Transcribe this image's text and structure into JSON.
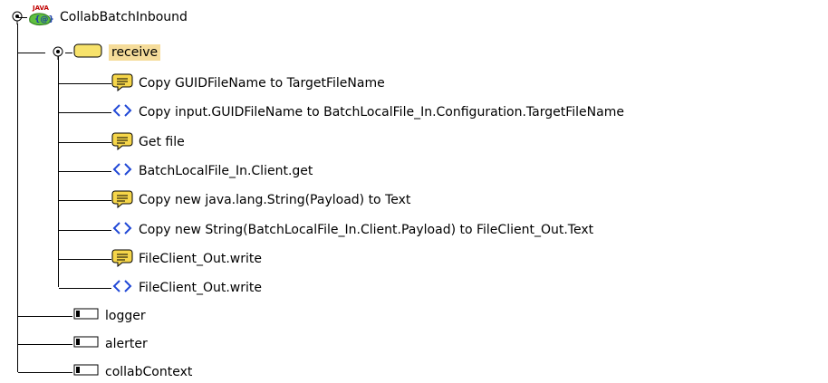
{
  "tree": {
    "root": {
      "label": "CollabBatchInbound",
      "icon": "java-collaboration-icon",
      "badge": "JAVA"
    },
    "method": {
      "label": "receive",
      "icon": "folder-icon",
      "selected": true
    },
    "steps": [
      {
        "kind": "comment",
        "icon": "comment-bubble-icon",
        "label": "Copy GUIDFileName to TargetFileName"
      },
      {
        "kind": "code",
        "icon": "code-brackets-icon",
        "label": "Copy input.GUIDFileName to BatchLocalFile_In.Configuration.TargetFileName"
      },
      {
        "kind": "comment",
        "icon": "comment-bubble-icon",
        "label": "Get file"
      },
      {
        "kind": "code",
        "icon": "code-brackets-icon",
        "label": "BatchLocalFile_In.Client.get"
      },
      {
        "kind": "comment",
        "icon": "comment-bubble-icon",
        "label": "Copy new java.lang.String(Payload) to Text"
      },
      {
        "kind": "code",
        "icon": "code-brackets-icon",
        "label": "Copy new String(BatchLocalFile_In.Client.Payload) to FileClient_Out.Text"
      },
      {
        "kind": "comment",
        "icon": "comment-bubble-icon",
        "label": "FileClient_Out.write"
      },
      {
        "kind": "code",
        "icon": "code-brackets-icon",
        "label": "FileClient_Out.write"
      }
    ],
    "fields": [
      {
        "icon": "field-icon",
        "label": "logger"
      },
      {
        "icon": "field-icon",
        "label": "alerter"
      },
      {
        "icon": "field-icon",
        "label": "collabContext"
      }
    ]
  },
  "colors": {
    "selection": "#f5dc9a",
    "comment": "#f6d64a",
    "code": "#1f47d6",
    "folder": "#f7e26b"
  }
}
